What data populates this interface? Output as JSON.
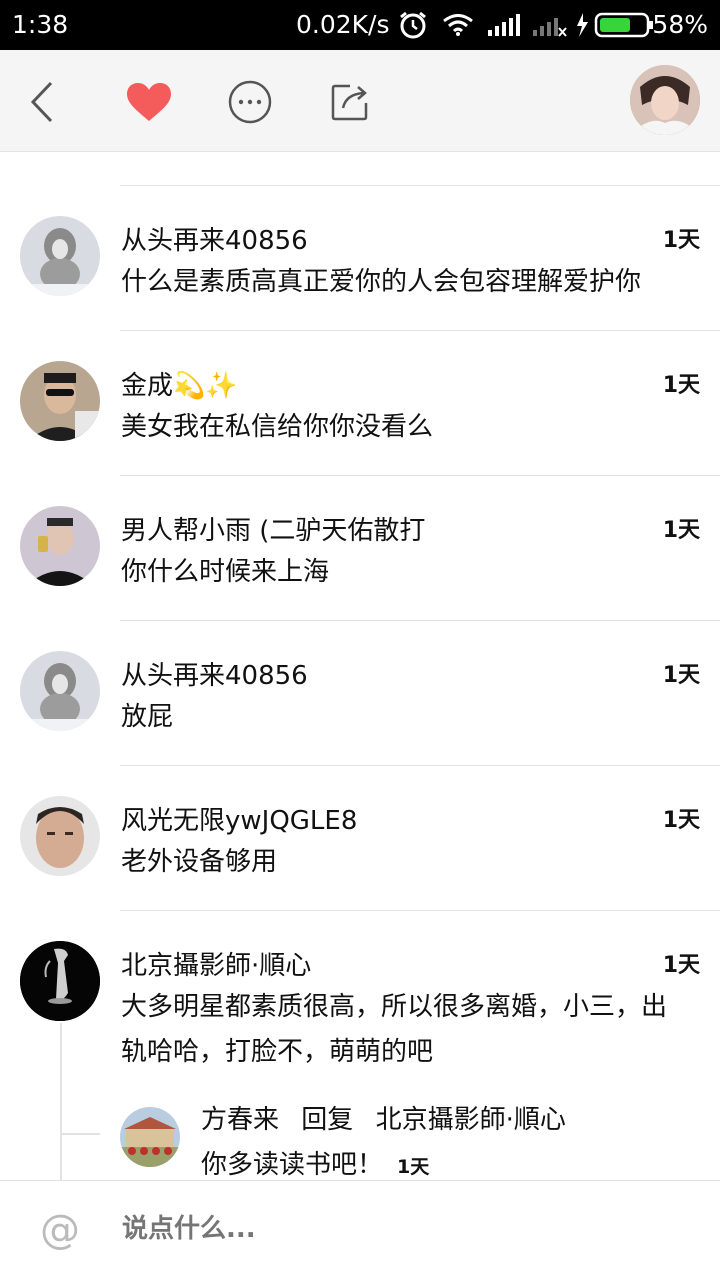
{
  "status_bar": {
    "time": "1:38",
    "net_speed": "0.02K/s",
    "battery": "58%"
  },
  "toolbar": {
    "icons": [
      "back-icon",
      "heart-icon",
      "more-icon",
      "share-icon",
      "avatar"
    ],
    "accent_color": "#f45b5b"
  },
  "comments": [
    {
      "name": "从头再来40856",
      "time": "1天",
      "text": "什么是素质高真正爱你的人会包容理解爱护你"
    },
    {
      "name": "金成💫✨",
      "time": "1天",
      "text": "美女我在私信给你你没看么"
    },
    {
      "name": "男人帮小雨 (二驴天佑散打",
      "time": "1天",
      "text": "你什么时候来上海"
    },
    {
      "name": "从头再来40856",
      "time": "1天",
      "text": "放屁"
    },
    {
      "name": "风光无限ywJQGLE8",
      "time": "1天",
      "text": "老外设备够用"
    },
    {
      "name": "北京攝影師·順心",
      "time": "1天",
      "text": "大多明星都素质很高，所以很多离婚，小三，出轨哈哈，打脸不，萌萌的吧"
    }
  ],
  "reply": {
    "name": "方春来",
    "action": "回复",
    "target": "北京攝影師·順心",
    "text": "你多读读书吧！",
    "time": "1天"
  },
  "input": {
    "placeholder": "说点什么..."
  }
}
